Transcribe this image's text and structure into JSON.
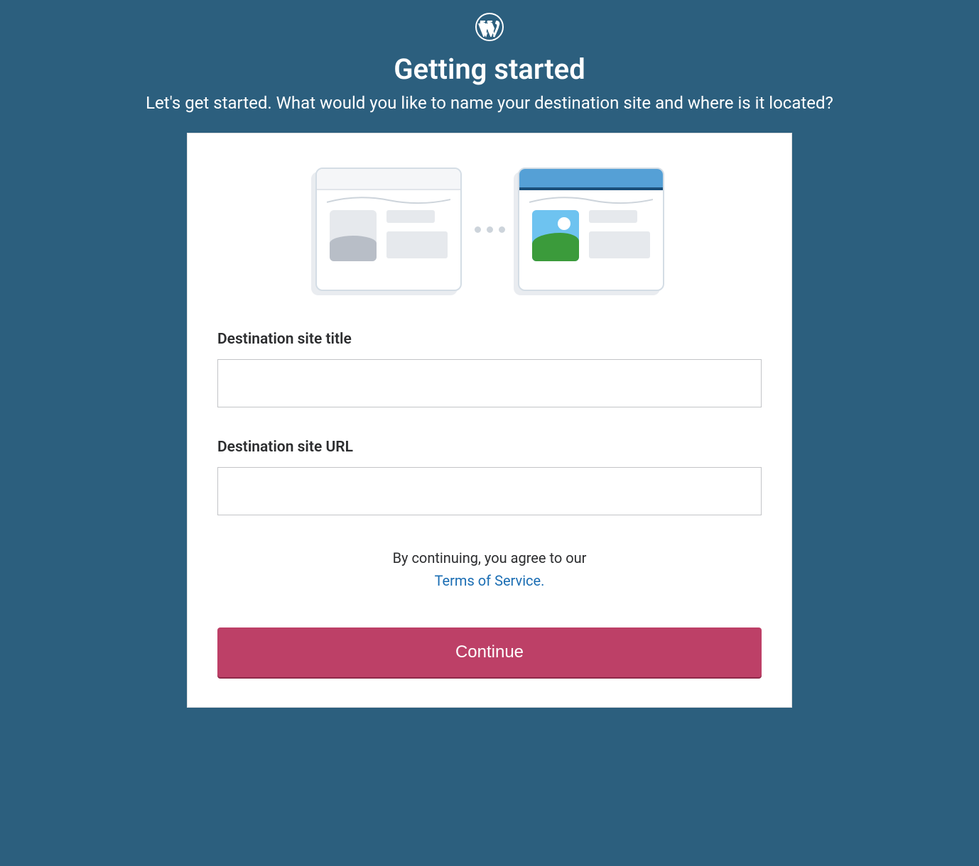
{
  "header": {
    "logo_name": "wordpress-logo",
    "title": "Getting started",
    "subtitle": "Let's get started. What would you like to name your destination site and where is it located?"
  },
  "form": {
    "site_title": {
      "label": "Destination site title",
      "value": "",
      "placeholder": ""
    },
    "site_url": {
      "label": "Destination site URL",
      "value": "",
      "placeholder": ""
    }
  },
  "tos": {
    "prefix": "By continuing, you agree to our",
    "link_text": "Terms of Service."
  },
  "buttons": {
    "continue": "Continue"
  },
  "colors": {
    "background": "#2c5f7e",
    "primary_button": "#bd4067",
    "link": "#1a6db3"
  }
}
